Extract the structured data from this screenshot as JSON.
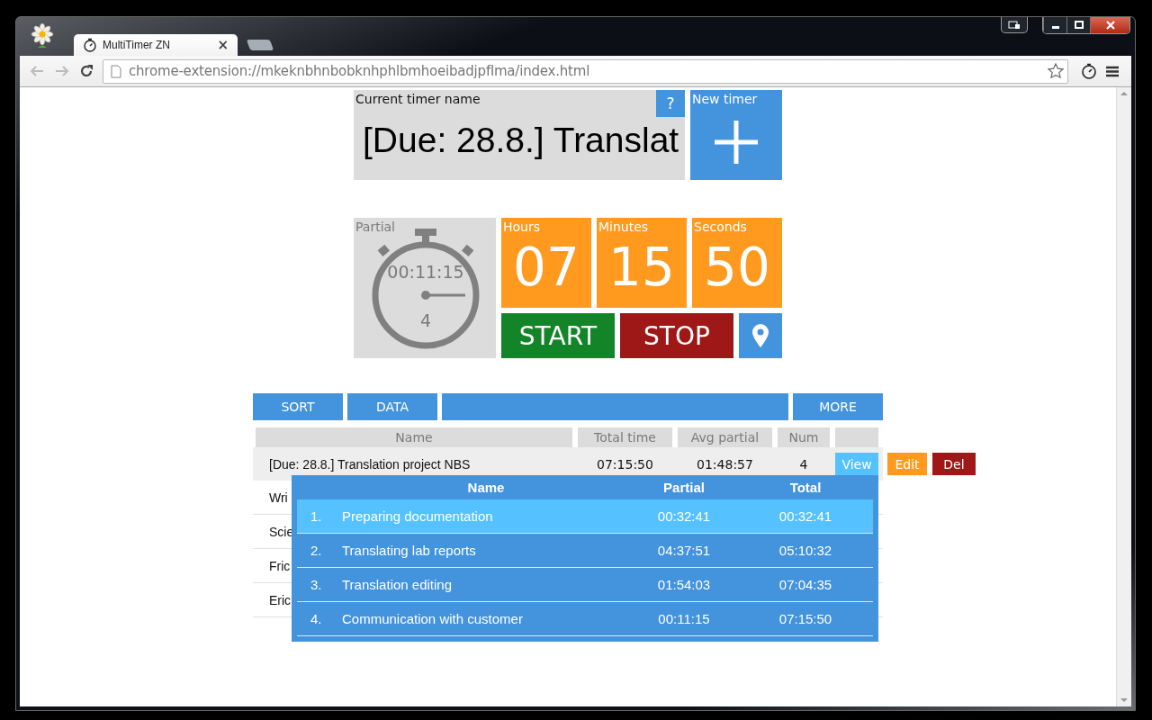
{
  "browser": {
    "tab": {
      "title": "MultiTimer ZN",
      "close": "×"
    },
    "address": "chrome-extension://mkeknbhnbobknhphlbmhoeibadjpflma/index.html"
  },
  "current_timer": {
    "label": "Current timer name",
    "name": "[Due: 28.8.] Translat",
    "help": "?"
  },
  "new_timer": {
    "label": "New timer"
  },
  "partial": {
    "label": "Partial",
    "time": "00:11:15",
    "count": "4"
  },
  "clock": [
    {
      "label": "Hours",
      "value": "07"
    },
    {
      "label": "Minutes",
      "value": "15"
    },
    {
      "label": "Seconds",
      "value": "50"
    }
  ],
  "controls": [
    {
      "kind": "start",
      "label": "START"
    },
    {
      "kind": "stop",
      "label": "STOP"
    },
    {
      "kind": "pin"
    }
  ],
  "toolbar": [
    {
      "kind": "button",
      "label": "SORT"
    },
    {
      "kind": "button",
      "label": "DATA"
    },
    {
      "kind": "spacer"
    },
    {
      "kind": "button",
      "label": "MORE"
    }
  ],
  "table": {
    "columns": [
      "Name",
      "Total time",
      "Avg partial",
      "Num"
    ],
    "rows": [
      {
        "name": "[Due: 28.8.] Translation project NBS",
        "total": "07:15:50",
        "avg": "01:48:57",
        "num": "4",
        "expanded": true,
        "actions": [
          {
            "kind": "view",
            "label": "View"
          },
          {
            "kind": "edit",
            "label": "Edit"
          },
          {
            "kind": "delete",
            "label": "Del"
          }
        ],
        "details": {
          "columns": [
            "Name",
            "Partial",
            "Total"
          ],
          "rows": [
            {
              "index": "1.",
              "name": "Preparing documentation",
              "partial": "00:32:41",
              "total": "00:32:41",
              "selected": true
            },
            {
              "index": "2.",
              "name": "Translating lab reports",
              "partial": "04:37:51",
              "total": "05:10:32",
              "selected": false
            },
            {
              "index": "3.",
              "name": "Translation editing",
              "partial": "01:54:03",
              "total": "07:04:35",
              "selected": false
            },
            {
              "index": "4.",
              "name": "Communication with customer",
              "partial": "00:11:15",
              "total": "07:15:50",
              "selected": false
            }
          ]
        }
      },
      {
        "name": "Wri",
        "expanded": false
      },
      {
        "name": "Scie",
        "expanded": false
      },
      {
        "name": "Fric",
        "expanded": false
      },
      {
        "name": "Eric",
        "expanded": false
      }
    ]
  }
}
